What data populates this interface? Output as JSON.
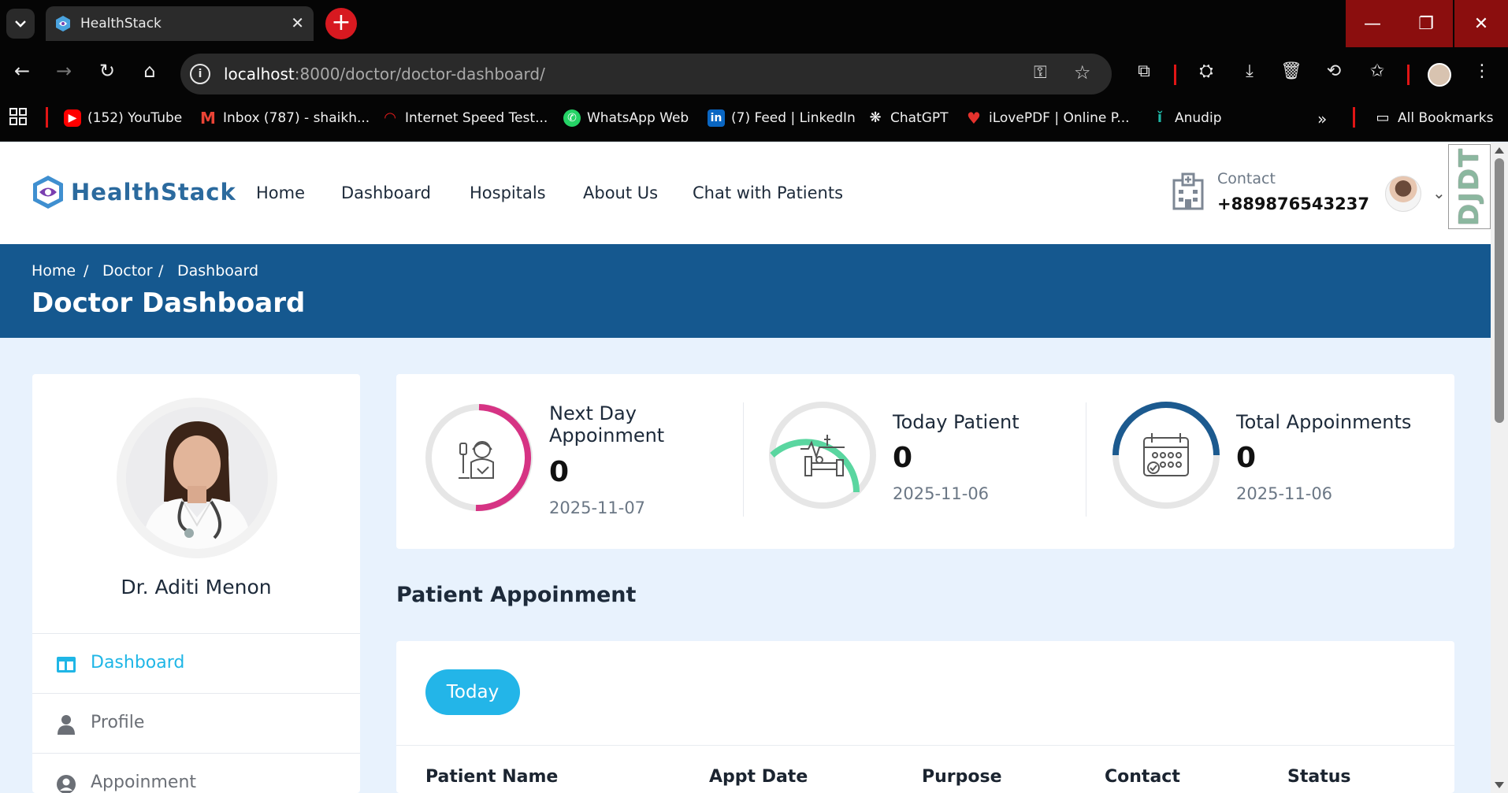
{
  "browser": {
    "tab_title": "HealthStack",
    "url_host": "localhost",
    "url_path": ":8000/doctor/doctor-dashboard/",
    "bookmarks": [
      {
        "label": "(152) YouTube",
        "icon": "youtube-icon",
        "color": "#ff0000"
      },
      {
        "label": "Inbox (787) - shaikh...",
        "icon": "gmail-icon",
        "color": "#ea4335"
      },
      {
        "label": "Internet Speed Test...",
        "icon": "speedtest-icon",
        "color": "#e21b1b"
      },
      {
        "label": "WhatsApp Web",
        "icon": "whatsapp-icon",
        "color": "#25d366"
      },
      {
        "label": "(7) Feed | LinkedIn",
        "icon": "linkedin-icon",
        "color": "#0a66c2"
      },
      {
        "label": "ChatGPT",
        "icon": "chatgpt-icon",
        "color": "#ffffff"
      },
      {
        "label": "iLovePDF | Online P...",
        "icon": "ilovepdf-icon",
        "color": "#e5322d"
      },
      {
        "label": "Anudip",
        "icon": "anudip-icon",
        "color": "#1fb6a6"
      }
    ],
    "all_bookmarks": "All Bookmarks"
  },
  "site": {
    "logo_text": "HealthStack",
    "nav": [
      "Home",
      "Dashboard",
      "Hospitals",
      "About Us",
      "Chat with Patients"
    ],
    "contact_label": "Contact",
    "contact_phone": "+889876543237",
    "djdt": "DJDT"
  },
  "banner": {
    "breadcrumb": [
      "Home",
      "/",
      "Doctor",
      "/",
      "Dashboard"
    ],
    "title": "Doctor Dashboard"
  },
  "sidebar": {
    "doctor_name": "Dr. Aditi Menon",
    "menu": [
      {
        "label": "Dashboard",
        "icon": "dashboard-icon",
        "active": true
      },
      {
        "label": "Profile",
        "icon": "user-icon",
        "active": false
      },
      {
        "label": "Appoinment",
        "icon": "user-circle-icon",
        "active": false
      }
    ]
  },
  "stats": [
    {
      "title_line1": "Next Day",
      "title_line2": "Appoinment",
      "value": "0",
      "date": "2025-11-07",
      "icon": "patient-drip-icon",
      "ring_color": "#d63384"
    },
    {
      "title_line1": "Today Patient",
      "title_line2": "",
      "value": "0",
      "date": "2025-11-06",
      "icon": "hospital-bed-icon",
      "ring_color": "#5ad6a0"
    },
    {
      "title_line1": "Total Appoinments",
      "title_line2": "",
      "value": "0",
      "date": "2025-11-06",
      "icon": "calendar-icon",
      "ring_color": "#1c5a8f"
    }
  ],
  "appointments": {
    "section_title": "Patient Appoinment",
    "filter_button": "Today",
    "columns": [
      "Patient Name",
      "Appt Date",
      "Purpose",
      "Contact",
      "Status"
    ]
  },
  "colors": {
    "brand_blue": "#15588f",
    "accent_cyan": "#23b5e8",
    "page_bg": "#e8f2fd"
  }
}
